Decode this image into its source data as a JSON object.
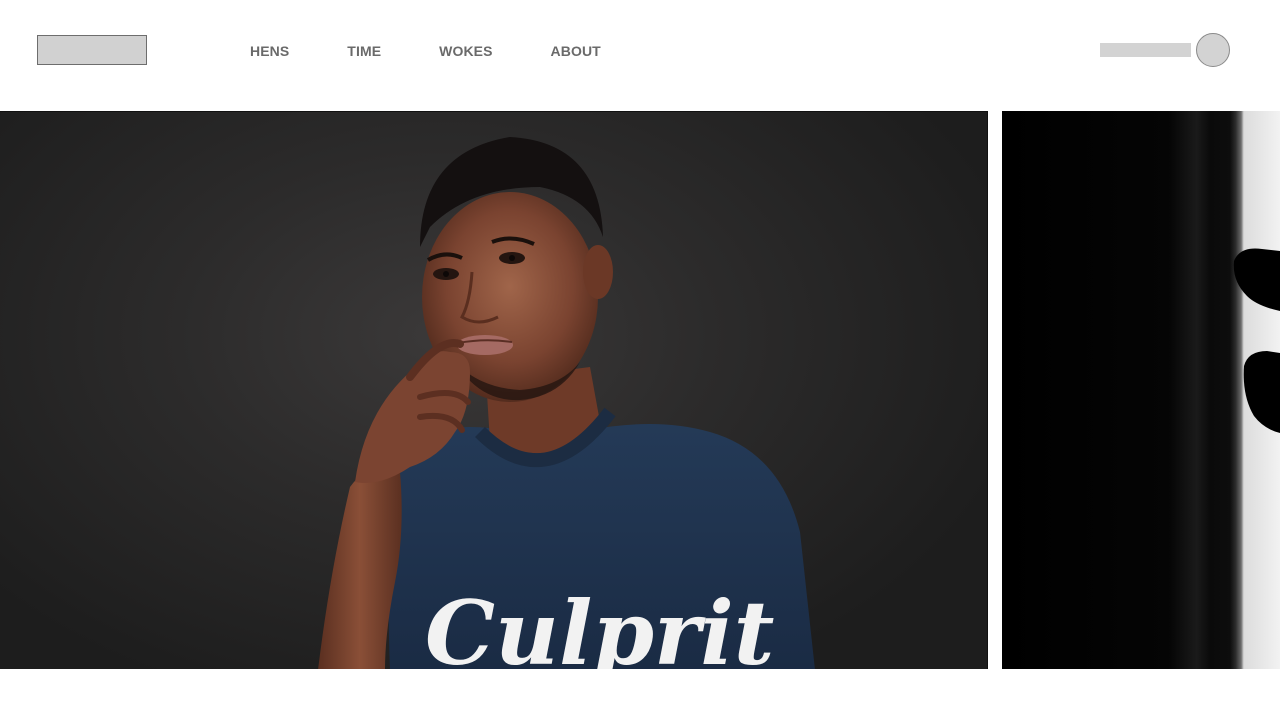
{
  "header": {
    "nav": [
      {
        "label": "HENS"
      },
      {
        "label": "TIME"
      },
      {
        "label": "WOKES"
      },
      {
        "label": "ABOUT"
      }
    ]
  },
  "gallery": {
    "slides": [
      {
        "shirt_text": "Culprit"
      }
    ]
  }
}
